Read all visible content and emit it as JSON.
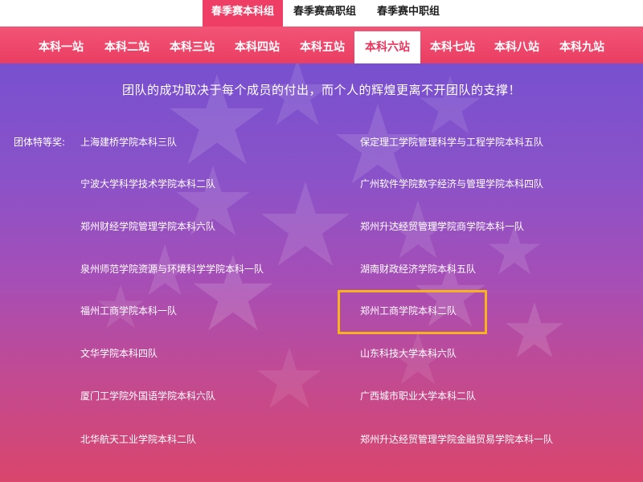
{
  "top_tabs": [
    {
      "label": "春季赛本科组",
      "active": true
    },
    {
      "label": "春季赛高职组",
      "active": false
    },
    {
      "label": "春季赛中职组",
      "active": false
    }
  ],
  "stations": [
    {
      "label": "本科一站",
      "active": false
    },
    {
      "label": "本科二站",
      "active": false
    },
    {
      "label": "本科三站",
      "active": false
    },
    {
      "label": "本科四站",
      "active": false
    },
    {
      "label": "本科五站",
      "active": false
    },
    {
      "label": "本科六站",
      "active": true
    },
    {
      "label": "本科七站",
      "active": false
    },
    {
      "label": "本科八站",
      "active": false
    },
    {
      "label": "本科九站",
      "active": false
    }
  ],
  "motto": "团队的成功取决于每个成员的付出，而个人的辉煌更离不开团队的支撑！",
  "award_label": "团体特等奖:",
  "teams_left": [
    "上海建桥学院本科三队",
    "宁波大学科学技术学院本科二队",
    "郑州财经学院管理学院本科六队",
    "泉州师范学院资源与环境科学学院本科一队",
    "福州工商学院本科一队",
    "文华学院本科四队",
    "厦门工学院外国语学院本科六队",
    "北华航天工业学院本科二队"
  ],
  "teams_right": [
    "保定理工学院管理科学与工程学院本科五队",
    "广州软件学院数字经济与管理学院本科四队",
    "郑州升达经贸管理学院商学院本科一队",
    "湖南财政经济学院本科五队",
    "郑州工商学院本科二队",
    "山东科技大学本科六队",
    "广西城市职业大学本科二队",
    "郑州升达经贸管理学院金融贸易学院本科一队"
  ],
  "highlighted_team": "郑州工商学院本科二队",
  "colors": {
    "accent": "#ee3e66",
    "highlight_border": "#f7b21e",
    "text": "#ffffff"
  }
}
